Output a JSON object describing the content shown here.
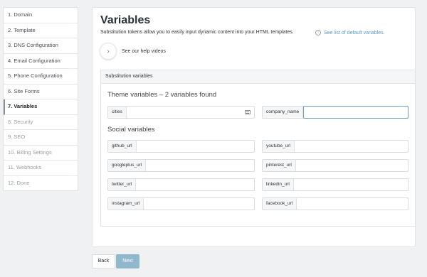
{
  "sidebar": {
    "items": [
      {
        "label": "1. Domain",
        "state": "done"
      },
      {
        "label": "2. Template",
        "state": "done"
      },
      {
        "label": "3. DNS Configuration",
        "state": "done"
      },
      {
        "label": "4. Email Configuration",
        "state": "done"
      },
      {
        "label": "5. Phone Configuration",
        "state": "done"
      },
      {
        "label": "6. Site Forms",
        "state": "done"
      },
      {
        "label": "7. Variables",
        "state": "active"
      },
      {
        "label": "8. Security",
        "state": "disabled"
      },
      {
        "label": "9. SEO",
        "state": "disabled"
      },
      {
        "label": "10. Billing Settings",
        "state": "disabled"
      },
      {
        "label": "11. Webhooks",
        "state": "disabled"
      },
      {
        "label": "12. Done",
        "state": "disabled"
      }
    ]
  },
  "main": {
    "title": "Variables",
    "subtitle": "Substitution tokens allow you to easily input dynamic content into your HTML templates.",
    "default_vars_link": "See list of default variables.",
    "help_text": "See our help videos",
    "box_header": "Substitution variables",
    "theme_title": "Theme variables – 2 variables found",
    "social_title": "Social variables",
    "theme_fields": [
      {
        "label": "cities",
        "value": ""
      },
      {
        "label": "company_name",
        "value": ""
      }
    ],
    "social_fields": [
      {
        "label": "github_url",
        "value": ""
      },
      {
        "label": "youtube_url",
        "value": ""
      },
      {
        "label": "googleplus_url",
        "value": ""
      },
      {
        "label": "pinterest_url",
        "value": ""
      },
      {
        "label": "twitter_url",
        "value": ""
      },
      {
        "label": "linkedin_url",
        "value": ""
      },
      {
        "label": "instagram_url",
        "value": ""
      },
      {
        "label": "facebook_url",
        "value": ""
      }
    ]
  },
  "footer": {
    "back_label": "Back",
    "next_label": "Next"
  },
  "colors": {
    "accent": "#5a9bc7",
    "next_button": "#8fb8cc",
    "focus_border": "#6d9fbf"
  }
}
